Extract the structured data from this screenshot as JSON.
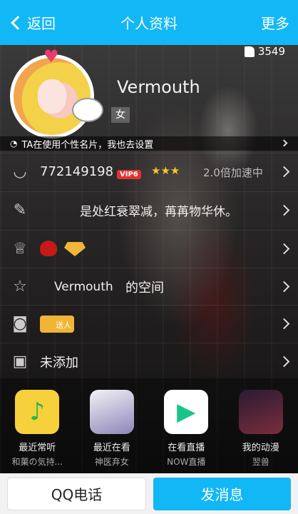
{
  "header": {
    "back_label": "返回",
    "title": "个人资料",
    "more_label": "更多"
  },
  "likes": {
    "count": "3549"
  },
  "profile": {
    "name": "Vermouth",
    "gender": "女"
  },
  "card_tip": "TA在使用个性名片，我也去设置",
  "rows": {
    "qq": {
      "number": "772149198",
      "vip": "VIP6",
      "crowns": "★★★",
      "speed": "2.0倍加速中"
    },
    "signature": "是处红衰翠减，苒苒物华休。",
    "space": {
      "owner": "Vermouth",
      "suffix": "的空间"
    },
    "gift_tag": "送人",
    "extra": "未添加"
  },
  "apps": [
    {
      "label": "最近常听",
      "sub": "和菓の気持...",
      "color": "#2ab54b"
    },
    {
      "label": "最近在看",
      "sub": "神医弃女",
      "color": "#e9e6f0"
    },
    {
      "label": "在看直播",
      "sub": "NOW直播",
      "color": "#19c48a"
    },
    {
      "label": "我的动漫",
      "sub": "翌兽",
      "color": "#4a2a4a"
    }
  ],
  "actions": {
    "call": "QQ电话",
    "message": "发消息"
  },
  "colors": {
    "accent": "#12b7f5",
    "vip_red": "#e0332f",
    "gold": "#f6c331"
  }
}
